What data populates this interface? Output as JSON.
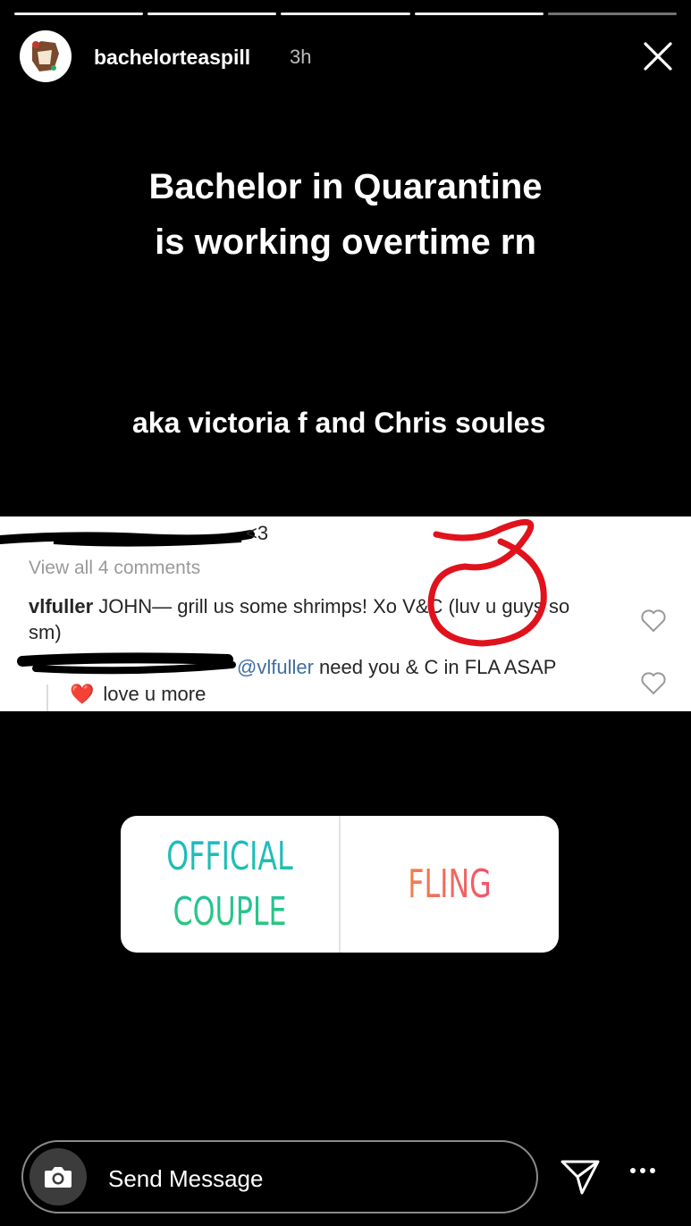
{
  "story": {
    "progress_segments": 5,
    "progress_done": 4,
    "username": "bachelorteaspill",
    "time": "3h",
    "headline_line1": "Bachelor in Quarantine",
    "headline_line2": "is working overtime rn",
    "subline": "aka victoria f and Chris soules"
  },
  "screenshot": {
    "partial": "<3",
    "view_all": "View all 4 comments",
    "comment1_user": "vlfuller",
    "comment1_text": "JOHN— grill us some shrimps! Xo V&C (luv u guys so sm)",
    "comment2_mention": "@vlfuller",
    "comment2_text": "need you & C in FLA ASAP",
    "comment2_heart": "❤️",
    "comment2_text2": "love u more"
  },
  "poll": {
    "option1_line1": "OFFICIAL",
    "option1_line2": "COUPLE",
    "option2": "FLING"
  },
  "composer": {
    "placeholder": "Send Message"
  },
  "colors": {
    "background": "#000000",
    "poll_option1": "#17b8d8",
    "poll_option2": "#f0427b",
    "annotation_circle": "#e0121c"
  }
}
